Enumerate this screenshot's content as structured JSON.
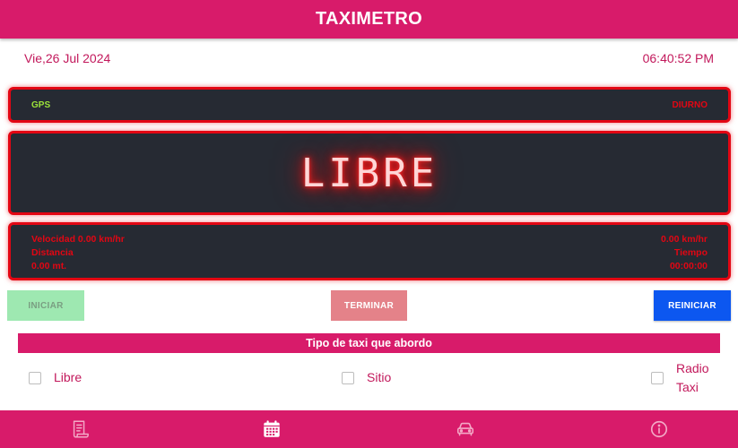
{
  "header": {
    "title": "TAXIMETRO"
  },
  "datetime": {
    "date": "Vie,26 Jul 2024",
    "time": "06:40:52 PM"
  },
  "top_panel": {
    "gps": "GPS",
    "mode": "DIURNO"
  },
  "display": {
    "status": "LIBRE"
  },
  "stats": {
    "speed": "Velocidad 0.00 km/hr",
    "distance_label": "Distancia",
    "distance_value": "0.00 mt.",
    "speed_right": "0.00 km/hr",
    "time_label": "Tiempo",
    "time_value": "00:00:00"
  },
  "buttons": {
    "start": "INICIAR",
    "end": "TERMINAR",
    "reset": "REINICIAR"
  },
  "taxi_type": {
    "title": "Tipo de taxi que abordo",
    "options": [
      {
        "label": "Libre",
        "checked": false
      },
      {
        "label": "Sitio",
        "checked": false
      },
      {
        "label": "Radio Taxi",
        "checked": false
      }
    ]
  },
  "nav": {
    "items": [
      {
        "icon": "receipt-icon"
      },
      {
        "icon": "calendar-icon"
      },
      {
        "icon": "car-icon"
      },
      {
        "icon": "info-icon"
      }
    ]
  },
  "colors": {
    "brand": "#d81b6a",
    "panel_bg": "#262a33",
    "panel_border": "#e30613",
    "gps_green": "#9be23a",
    "start_button": "#9ee8b1",
    "end_button": "#e48289",
    "reset_button": "#0c57f0"
  }
}
